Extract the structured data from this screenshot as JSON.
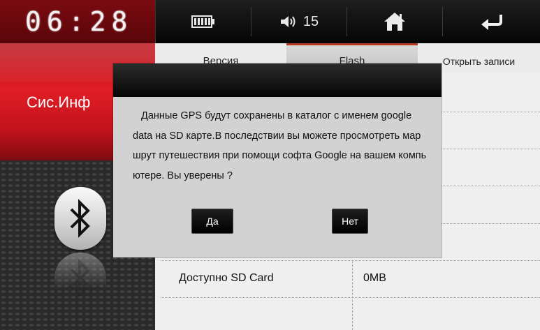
{
  "clock": {
    "time": "06:28"
  },
  "left_panel": {
    "title": "Сис.Инф",
    "bluetooth_icon": "bluetooth-icon"
  },
  "status_bar": {
    "battery_icon": "battery-icon",
    "volume_icon": "speaker-volume-icon",
    "volume_level": "15",
    "home_icon": "home-icon",
    "back_icon": "back-arrow-icon"
  },
  "tabs": [
    {
      "label": "Версия",
      "active": false
    },
    {
      "label": "Flash",
      "active": true
    },
    {
      "label": "Открыть записи",
      "active": false
    }
  ],
  "info_rows": [
    {
      "label": "Доступно SD Card",
      "value": "0MB"
    }
  ],
  "dialog": {
    "message_lines": [
      "Данные GPS будут сохранены в каталог с именем google",
      "data на SD карте.В последствии вы можете просмотреть мар",
      "шрут путешествия при помощи софта Google на вашем компь",
      "ютере. Вы уверены ?"
    ],
    "yes_label": "Да",
    "no_label": "Нет"
  },
  "colors": {
    "accent_red": "#e01e26",
    "tab_active_border": "#b73a1a",
    "dialog_background": "#d2d2d2"
  }
}
